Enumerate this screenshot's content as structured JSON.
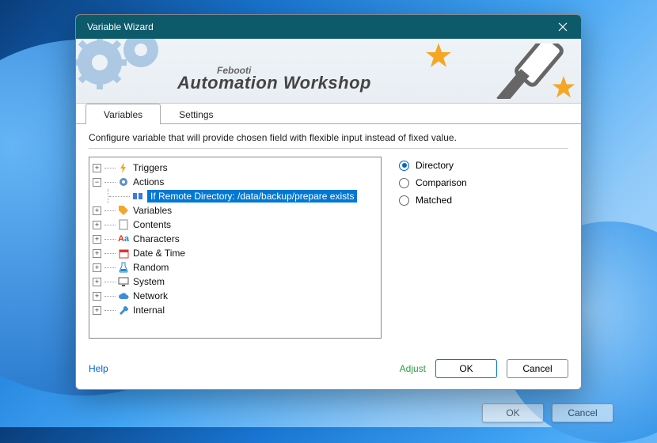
{
  "window": {
    "title": "Variable Wizard"
  },
  "banner": {
    "brand_sub": "Febooti",
    "brand_title": "Automation Workshop"
  },
  "tabs": {
    "variables": "Variables",
    "settings": "Settings"
  },
  "instructions": "Configure variable that will provide chosen field with flexible input instead of fixed value.",
  "tree": {
    "triggers": "Triggers",
    "actions": "Actions",
    "actions_child": "If Remote Directory: /data/backup/prepare exists",
    "variables": "Variables",
    "contents": "Contents",
    "characters": "Characters",
    "date_time": "Date & Time",
    "random": "Random",
    "system": "System",
    "network": "Network",
    "internal": "Internal"
  },
  "radios": {
    "directory": "Directory",
    "comparison": "Comparison",
    "matched": "Matched"
  },
  "footer": {
    "help": "Help",
    "adjust": "Adjust",
    "ok": "OK",
    "cancel": "Cancel"
  }
}
